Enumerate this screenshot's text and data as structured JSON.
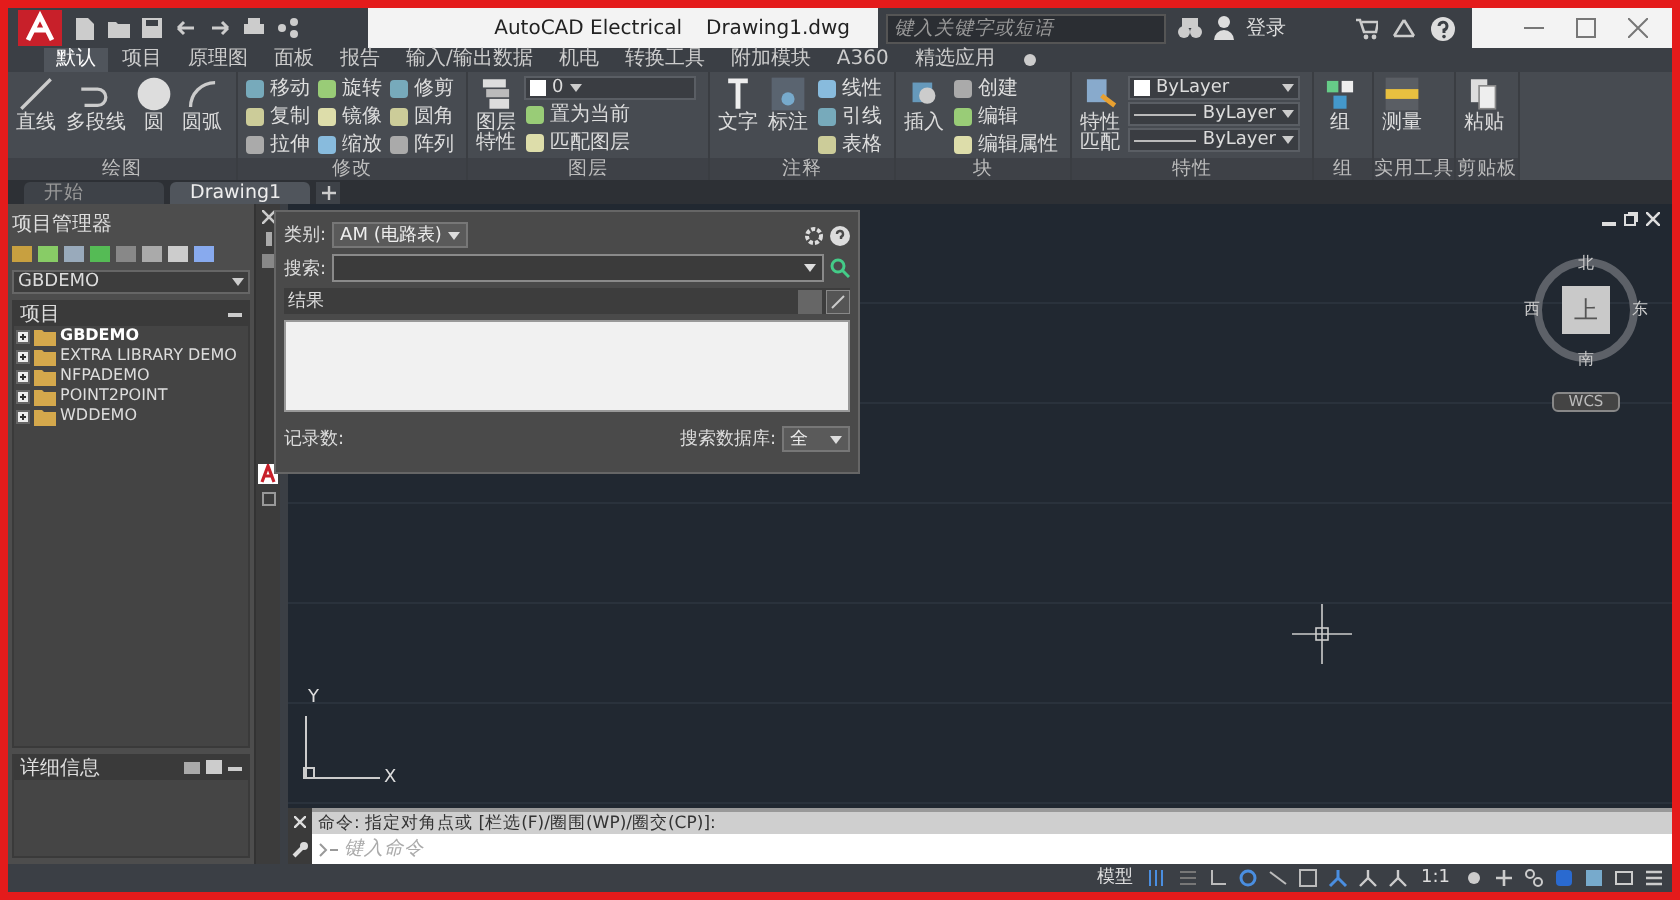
{
  "window": {
    "title": "AutoCAD Electrical",
    "document": "Drawing1.dwg"
  },
  "search": {
    "placeholder": "键入关键字或短语"
  },
  "account": {
    "label": "登录"
  },
  "ribbon_tabs": [
    {
      "label": "默认",
      "selected": true
    },
    {
      "label": "项目",
      "selected": false
    },
    {
      "label": "原理图",
      "selected": false
    },
    {
      "label": "面板",
      "selected": false
    },
    {
      "label": "报告",
      "selected": false
    },
    {
      "label": "输入/输出数据",
      "selected": false
    },
    {
      "label": "机电",
      "selected": false
    },
    {
      "label": "转换工具",
      "selected": false
    },
    {
      "label": "附加模块",
      "selected": false
    },
    {
      "label": "A360",
      "selected": false
    },
    {
      "label": "精选应用",
      "selected": false
    }
  ],
  "ribbon_panels": [
    {
      "title": "绘图",
      "tools": [
        {
          "kind": "large",
          "label": "直线"
        },
        {
          "kind": "large",
          "label": "多段线"
        },
        {
          "kind": "large",
          "label": "圆"
        },
        {
          "kind": "large",
          "label": "圆弧"
        }
      ]
    },
    {
      "title": "修改",
      "tools": [
        {
          "kind": "stack",
          "items": [
            {
              "kind": "small",
              "label": "移动"
            },
            {
              "kind": "small",
              "label": "复制"
            },
            {
              "kind": "small",
              "label": "拉伸"
            }
          ]
        },
        {
          "kind": "stack",
          "items": [
            {
              "kind": "small",
              "label": "旋转"
            },
            {
              "kind": "small",
              "label": "镜像"
            },
            {
              "kind": "small",
              "label": "缩放"
            }
          ]
        },
        {
          "kind": "stack",
          "items": [
            {
              "kind": "small",
              "label": "修剪"
            },
            {
              "kind": "small",
              "label": "圆角"
            },
            {
              "kind": "small",
              "label": "阵列"
            }
          ]
        }
      ]
    },
    {
      "title": "图层",
      "tools": [
        {
          "kind": "large",
          "label": "图层特性"
        },
        {
          "kind": "stack",
          "items": [
            {
              "kind": "dropdown",
              "value": "0"
            },
            {
              "kind": "small",
              "label": "置为当前"
            },
            {
              "kind": "small",
              "label": "匹配图层"
            }
          ]
        }
      ]
    },
    {
      "title": "注释",
      "tools": [
        {
          "kind": "large",
          "label": "文字"
        },
        {
          "kind": "large",
          "label": "标注"
        },
        {
          "kind": "stack",
          "items": [
            {
              "kind": "small",
              "label": "线性"
            },
            {
              "kind": "small",
              "label": "引线"
            },
            {
              "kind": "small",
              "label": "表格"
            }
          ]
        }
      ]
    },
    {
      "title": "块",
      "tools": [
        {
          "kind": "large",
          "label": "插入"
        },
        {
          "kind": "stack",
          "items": [
            {
              "kind": "small",
              "label": "创建"
            },
            {
              "kind": "small",
              "label": "编辑"
            },
            {
              "kind": "small",
              "label": "编辑属性"
            }
          ]
        }
      ]
    },
    {
      "title": "特性",
      "tools": [
        {
          "kind": "large",
          "label": "特性匹配"
        },
        {
          "kind": "stack",
          "items": [
            {
              "kind": "dropdown",
              "value": "ByLayer"
            },
            {
              "kind": "dropdown",
              "value": "ByLayer"
            },
            {
              "kind": "dropdown",
              "value": "ByLayer"
            }
          ]
        }
      ]
    },
    {
      "title": "组",
      "tools": [
        {
          "kind": "large",
          "label": "组"
        }
      ]
    },
    {
      "title": "实用工具",
      "tools": [
        {
          "kind": "large",
          "label": "测量"
        }
      ]
    },
    {
      "title": "剪贴板",
      "tools": [
        {
          "kind": "large",
          "label": "粘贴"
        }
      ]
    }
  ],
  "document_tabs": [
    {
      "label": "开始",
      "selected": false
    },
    {
      "label": "Drawing1",
      "selected": true
    }
  ],
  "project_manager": {
    "title": "项目管理器",
    "project": "GBDEMO",
    "tree_header": "项目",
    "projects": [
      {
        "label": "GBDEMO",
        "active": true
      },
      {
        "label": "EXTRA LIBRARY DEMO",
        "active": false
      },
      {
        "label": "NFPADEMO",
        "active": false
      },
      {
        "label": "POINT2POINT",
        "active": false
      },
      {
        "label": "WDDEMO",
        "active": false
      }
    ],
    "details_title": "详细信息"
  },
  "library_dialog": {
    "category_label": "类别:",
    "category": "AM (电路表)",
    "search_label": "搜索:",
    "results_label": "结果",
    "record_count_label": "记录数:",
    "database_label": "搜索数据库:",
    "database": "全"
  },
  "viewcube": {
    "north": "北",
    "south": "南",
    "east": "东",
    "west": "西",
    "face": "上",
    "coordinate_system": "WCS"
  },
  "ucs": {
    "x": "X",
    "y": "Y"
  },
  "command_line": {
    "history": "命令: 指定对角点或 [栏选(F)/圈围(WP)/圈交(CP)]:",
    "placeholder": "键入命令"
  },
  "status_bar": {
    "model": "模型",
    "scale": "1:1"
  }
}
